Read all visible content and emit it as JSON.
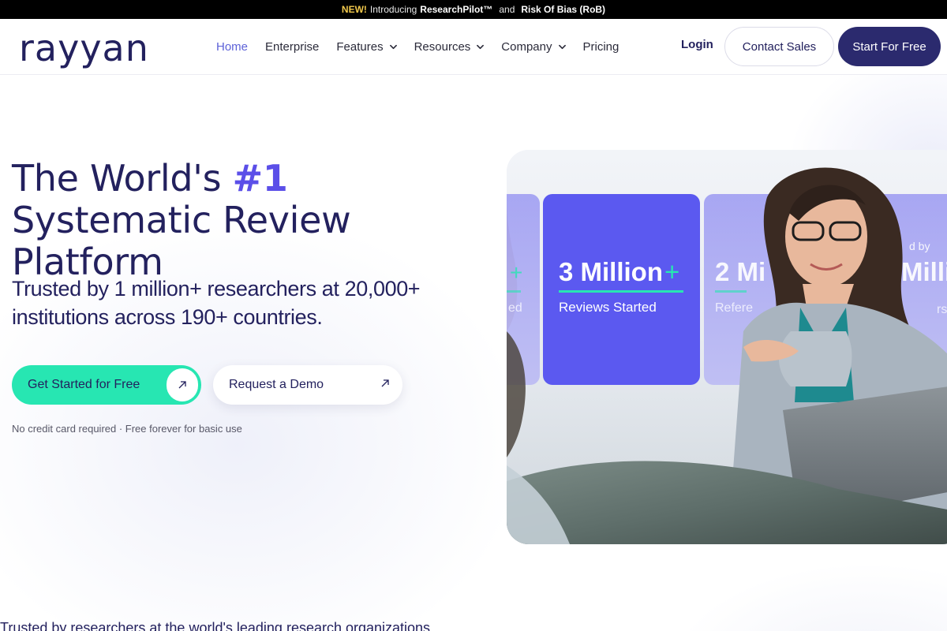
{
  "announcement": {
    "new_label": "NEW!",
    "intro": "Introducing",
    "product": "ResearchPilot™",
    "and": "and",
    "feature": "Risk Of Bias (RoB)"
  },
  "logo": {
    "text": "rayyan"
  },
  "nav": {
    "items": [
      {
        "label": "Home",
        "active": true,
        "dropdown": false
      },
      {
        "label": "Enterprise",
        "active": false,
        "dropdown": false
      },
      {
        "label": "Features",
        "active": false,
        "dropdown": true
      },
      {
        "label": "Resources",
        "active": false,
        "dropdown": true
      },
      {
        "label": "Company",
        "active": false,
        "dropdown": true
      },
      {
        "label": "Pricing",
        "active": false,
        "dropdown": false
      }
    ],
    "login": "Login",
    "contact_sales": "Contact Sales",
    "start_free": "Start For Free"
  },
  "hero": {
    "title_pre": "The World's ",
    "title_accent": "#1",
    "title_post": " Systematic Review Platform",
    "subtitle": "Trusted by 1 million+ researchers at 20,000+ institutions across 190+ countries.",
    "primary_cta": "Get Started for Free",
    "secondary_cta": "Request a Demo",
    "note": "No credit card required · Free forever for basic use"
  },
  "hero_image": {
    "stat_main_value": "3 Million",
    "stat_main_plus": "+",
    "stat_main_label": "Reviews Started",
    "stat_partial_value": "2 Mi",
    "stat_partial_label": "Refere",
    "stat_left_plus": "+",
    "stat_left_label": "ed",
    "stat_right_top": "d by",
    "stat_right_value": "Milli",
    "stat_right_label": "rs",
    "colors": {
      "card_main": "#5b59f0",
      "card_side": "#8d8cf0",
      "accent_line": "#27e6b2"
    }
  },
  "trusted_heading": "Trusted by researchers at the world's leading research organizations"
}
